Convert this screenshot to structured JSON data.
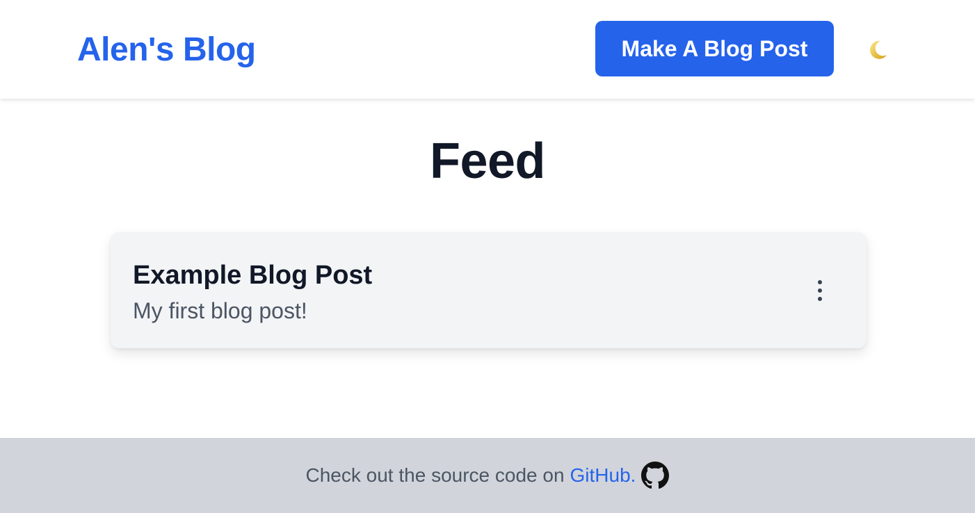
{
  "header": {
    "brand": "Alen's Blog",
    "make_post_label": "Make A Blog Post",
    "theme_toggle_icon": "moon-icon"
  },
  "main": {
    "title": "Feed",
    "posts": [
      {
        "title": "Example Blog Post",
        "excerpt": "My first blog post!",
        "menu_icon": "more-vertical-icon"
      }
    ]
  },
  "footer": {
    "text": "Check out the source code on",
    "link_label": "GitHub.",
    "icon": "github-icon"
  },
  "colors": {
    "accent": "#2563eb",
    "heading": "#111827",
    "muted": "#4b5563",
    "card_bg": "#f3f4f6",
    "footer_bg": "#d1d5db"
  }
}
